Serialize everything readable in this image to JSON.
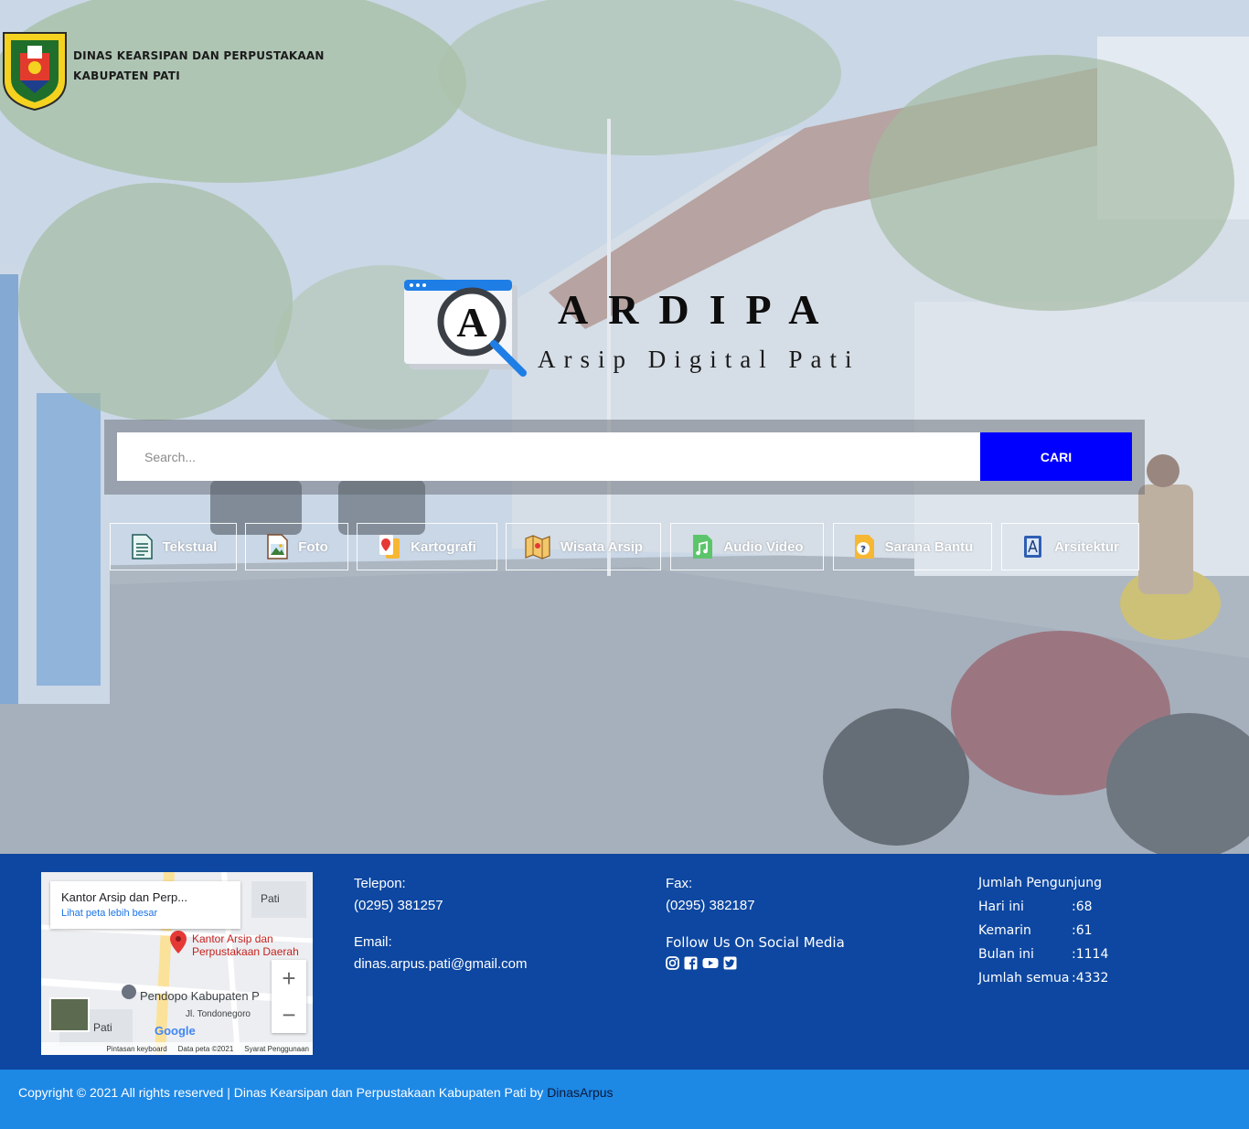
{
  "brand": {
    "line1": "DINAS KEARSIPAN DAN PERPUSTAKAAN",
    "line2": "KABUPATEN PATI"
  },
  "app": {
    "title": "ARDIPA",
    "subtitle": "Arsip Digital Pati"
  },
  "search": {
    "placeholder": "Search...",
    "button_label": "CARI"
  },
  "categories": [
    {
      "label": "Tekstual",
      "icon": "document-icon"
    },
    {
      "label": "Foto",
      "icon": "photo-icon"
    },
    {
      "label": "Kartografi",
      "icon": "map-pin-icon"
    },
    {
      "label": "Wisata Arsip",
      "icon": "folded-map-icon"
    },
    {
      "label": "Audio Video",
      "icon": "music-file-icon"
    },
    {
      "label": "Sarana Bantu",
      "icon": "help-file-icon"
    },
    {
      "label": "Arsitektur",
      "icon": "architecture-book-icon"
    }
  ],
  "map": {
    "place_title": "Kantor Arsip dan Perp...",
    "view_larger": "Lihat peta lebih besar",
    "marker_label": "Kantor Arsip dan Perpustakaan Daerah",
    "poi1": "Pendopo Kabupaten P",
    "street": "Jl. Tondonegoro",
    "place_city": "Pati",
    "place_city2": "Pati",
    "brand": "Google",
    "footer_keyboard": "Pintasan keyboard",
    "footer_data": "Data peta ©2021",
    "footer_terms": "Syarat Penggunaan"
  },
  "contact": {
    "phone_label": "Telepon:",
    "phone_value": "(0295) 381257",
    "email_label": "Email:",
    "email_value": "dinas.arpus.pati@gmail.com",
    "fax_label": "Fax:",
    "fax_value": "(0295) 382187",
    "social_label": "Follow Us On Social Media",
    "social_icons": [
      "instagram-icon",
      "facebook-icon",
      "youtube-icon",
      "twitter-icon"
    ]
  },
  "visitors": {
    "title": "Jumlah Pengunjung",
    "rows": [
      {
        "label": "Hari ini",
        "value": ":68"
      },
      {
        "label": "Kemarin",
        "value": ":61"
      },
      {
        "label": "Bulan ini",
        "value": ":1114"
      },
      {
        "label": "Jumlah semua",
        "value": ":4332"
      }
    ]
  },
  "copyright": {
    "text": "Copyright © 2021 All rights reserved | Dinas Kearsipan dan Perpustakaan Kabupaten Pati by ",
    "link": "DinasArpus"
  },
  "colors": {
    "search_button": "#0000ff",
    "footer_bg": "#0d47a1",
    "copyright_bg": "#1e88e5"
  }
}
